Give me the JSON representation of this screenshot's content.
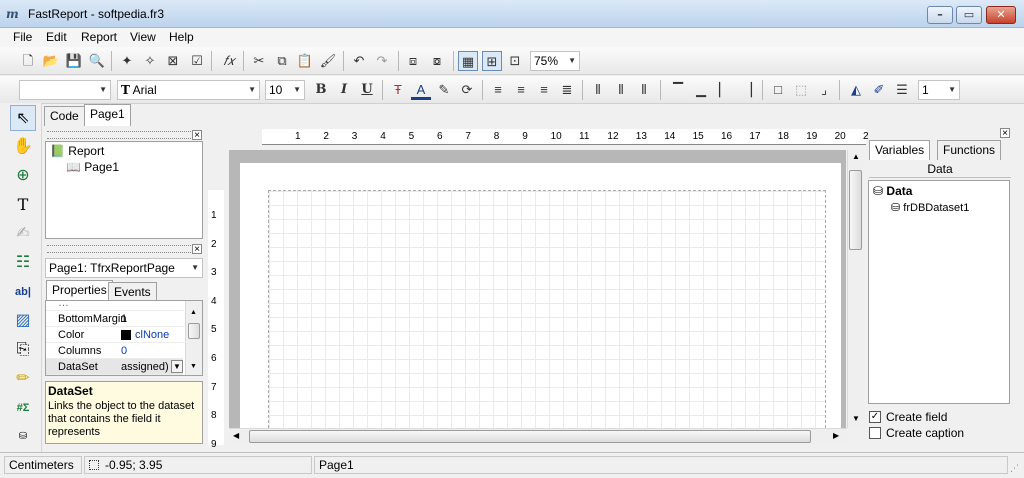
{
  "window": {
    "title": "FastReport - softpedia.fr3",
    "app_icon_label": "m",
    "minimize": "–",
    "maximize": "▭",
    "close": "✕"
  },
  "menu": [
    "File",
    "Edit",
    "Report",
    "View",
    "Help"
  ],
  "toolbar1": {
    "zoom": "75%"
  },
  "toolbar2": {
    "style_value": "",
    "font_name": "Arial",
    "font_size": "10",
    "bold": "B",
    "italic": "I",
    "underline": "U",
    "line_width": "1"
  },
  "tabs_top": {
    "code": "Code",
    "page1": "Page1"
  },
  "report_tree": {
    "root": "Report",
    "child": "Page1"
  },
  "object_selector": "Page1: TfrxReportPage",
  "inspector_tabs": {
    "properties": "Properties",
    "events": "Events"
  },
  "properties": [
    {
      "name": "BottomMargin",
      "value": "1",
      "swatch": ""
    },
    {
      "name": "Color",
      "value": "clNone",
      "swatch": "#000000"
    },
    {
      "name": "Columns",
      "value": "0",
      "swatch": ""
    },
    {
      "name": "DataSet",
      "value": "assigned)",
      "swatch": ""
    }
  ],
  "help": {
    "title": "DataSet",
    "text": "Links the object to the dataset that contains the field it represents"
  },
  "ruler_h": [
    "1",
    "2",
    "3",
    "4",
    "5",
    "6",
    "7",
    "8",
    "9",
    "10",
    "11",
    "12",
    "13",
    "14",
    "15",
    "16",
    "17",
    "18",
    "19",
    "20",
    "2"
  ],
  "ruler_v": [
    "1",
    "2",
    "3",
    "4",
    "5",
    "6",
    "7",
    "8",
    "9"
  ],
  "data_panel": {
    "tab_variables": "Variables",
    "tab_functions": "Functions",
    "tab_data": "Data",
    "tree_root": "Data",
    "tree_child": "frDBDataset1",
    "create_field": "Create field",
    "create_field_checked": true,
    "create_caption": "Create caption",
    "create_caption_checked": false
  },
  "status": {
    "units": "Centimeters",
    "coords": "-0.95; 3.95",
    "page": "Page1"
  },
  "colors": {
    "title_gradient_top": "#dce9f7",
    "canvas": "#b7b7b7",
    "close_button": "#c7432b"
  }
}
